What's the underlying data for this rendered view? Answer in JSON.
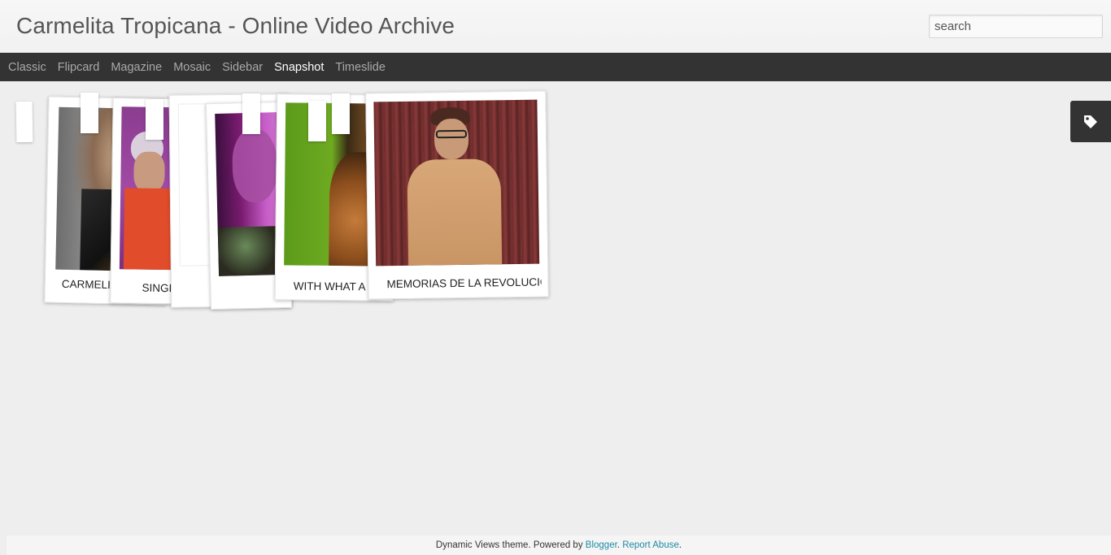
{
  "header": {
    "title": "Carmelita Tropicana - Online Video Archive",
    "search_placeholder": "search"
  },
  "nav": {
    "items": [
      {
        "label": "Classic"
      },
      {
        "label": "Flipcard"
      },
      {
        "label": "Magazine"
      },
      {
        "label": "Mosaic"
      },
      {
        "label": "Sidebar"
      },
      {
        "label": "Snapshot",
        "active": true
      },
      {
        "label": "Timeslide"
      }
    ]
  },
  "tag_tab": {
    "icon": "tag-icon"
  },
  "photos": [
    {
      "caption": "CARMELITA",
      "icon": "video-thumbnail"
    },
    {
      "caption": "SINGING",
      "icon": "video-thumbnail"
    },
    {
      "caption": "",
      "icon": "video-thumbnail"
    },
    {
      "caption": "",
      "icon": "video-thumbnail"
    },
    {
      "caption": "WITH WHAT A",
      "icon": "video-thumbnail"
    },
    {
      "caption": "MEMORIAS DE LA REVOLUCIÓN",
      "icon": "video-thumbnail"
    }
  ],
  "footer": {
    "prefix": "Dynamic Views theme. Powered by ",
    "blogger_link": "Blogger",
    "separator": ". ",
    "report_link": "Report Abuse",
    "suffix": "."
  },
  "colors": {
    "nav_bg": "#333333",
    "nav_active": "#ffffff",
    "nav_inactive": "#a9a9a9",
    "link": "#1e8ba5",
    "page_bg": "#eeeeee"
  }
}
